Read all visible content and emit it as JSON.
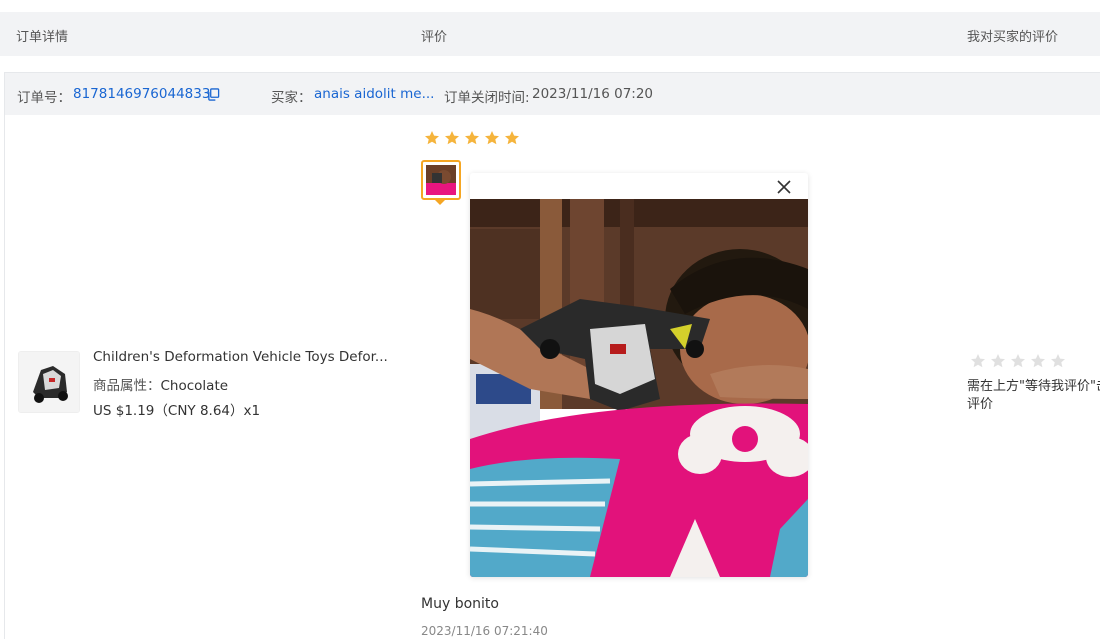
{
  "header": {
    "col_order": "订单详情",
    "col_review": "评价",
    "col_my_review": "我对买家的评价"
  },
  "order": {
    "order_no_label": "订单号：",
    "order_no": "8178146976044833",
    "buyer_label": "买家：",
    "buyer_name": "anais aidolit me...",
    "closed_label": "订单关闭时间:",
    "closed_time": "2023/11/16 07:20"
  },
  "product": {
    "title": "Children's Deformation Vehicle Toys Defor...",
    "attr_label": "商品属性：",
    "attr_value": "Chocolate",
    "price": "US $1.19（CNY  8.64）x1"
  },
  "buyer_review": {
    "rating": 5,
    "max_rating": 5,
    "text": "Muy bonito",
    "time": "2023/11/16 07:21:40"
  },
  "seller_review": {
    "rating": 0,
    "max_rating": 5,
    "hint": "需在上方\"等待我评价\"击评价"
  },
  "colors": {
    "star_active": "#f5b43c",
    "star_inactive": "#e0e0e0",
    "link": "#1a66d2",
    "highlight_border": "#f5a623",
    "header_bg": "#f2f3f5"
  },
  "icons": {
    "copy": "copy-icon",
    "close": "close-icon",
    "star": "star-icon"
  }
}
